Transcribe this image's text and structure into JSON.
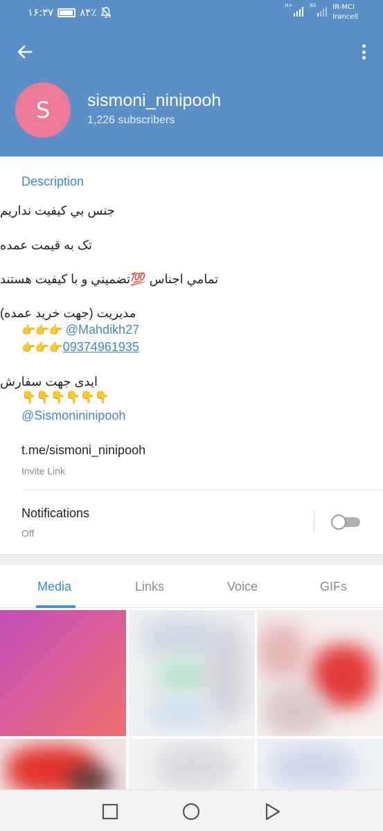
{
  "status_bar": {
    "time": "۱۶:۳۷",
    "battery": "۸۴٪",
    "battery_level": 0.84,
    "network_tags": [
      "H+",
      "3G"
    ],
    "carrier_line1": "IR-MCI",
    "carrier_line2": "Irancell"
  },
  "header": {
    "avatar_letter": "S",
    "channel_name": "sismoni_ninipooh",
    "subscribers": "1,226 subscribers"
  },
  "info": {
    "description_header": "Description",
    "line1": "جنس بي كيفيت نداريم",
    "line2": "تک به قیمت عمده",
    "line3_text": "تمامي اجناس ",
    "line3_emoji": "💯",
    "line3_rest": "تضميني و با كيفيت هستند",
    "line4": "مدیریت (جهت خرید عمده)",
    "contact_handle": "@Mahdikh27",
    "contact_phone": "09374961935",
    "line5": "ایدی جهت سفارش",
    "order_handle": "@Sismonininipooh",
    "invite_url": "t.me/sismoni_ninipooh",
    "invite_label": "Invite Link",
    "notifications_title": "Notifications",
    "notifications_value": "Off"
  },
  "tabs": [
    {
      "label": "Media"
    },
    {
      "label": "Links"
    },
    {
      "label": "Voice"
    },
    {
      "label": "GIFs"
    }
  ]
}
